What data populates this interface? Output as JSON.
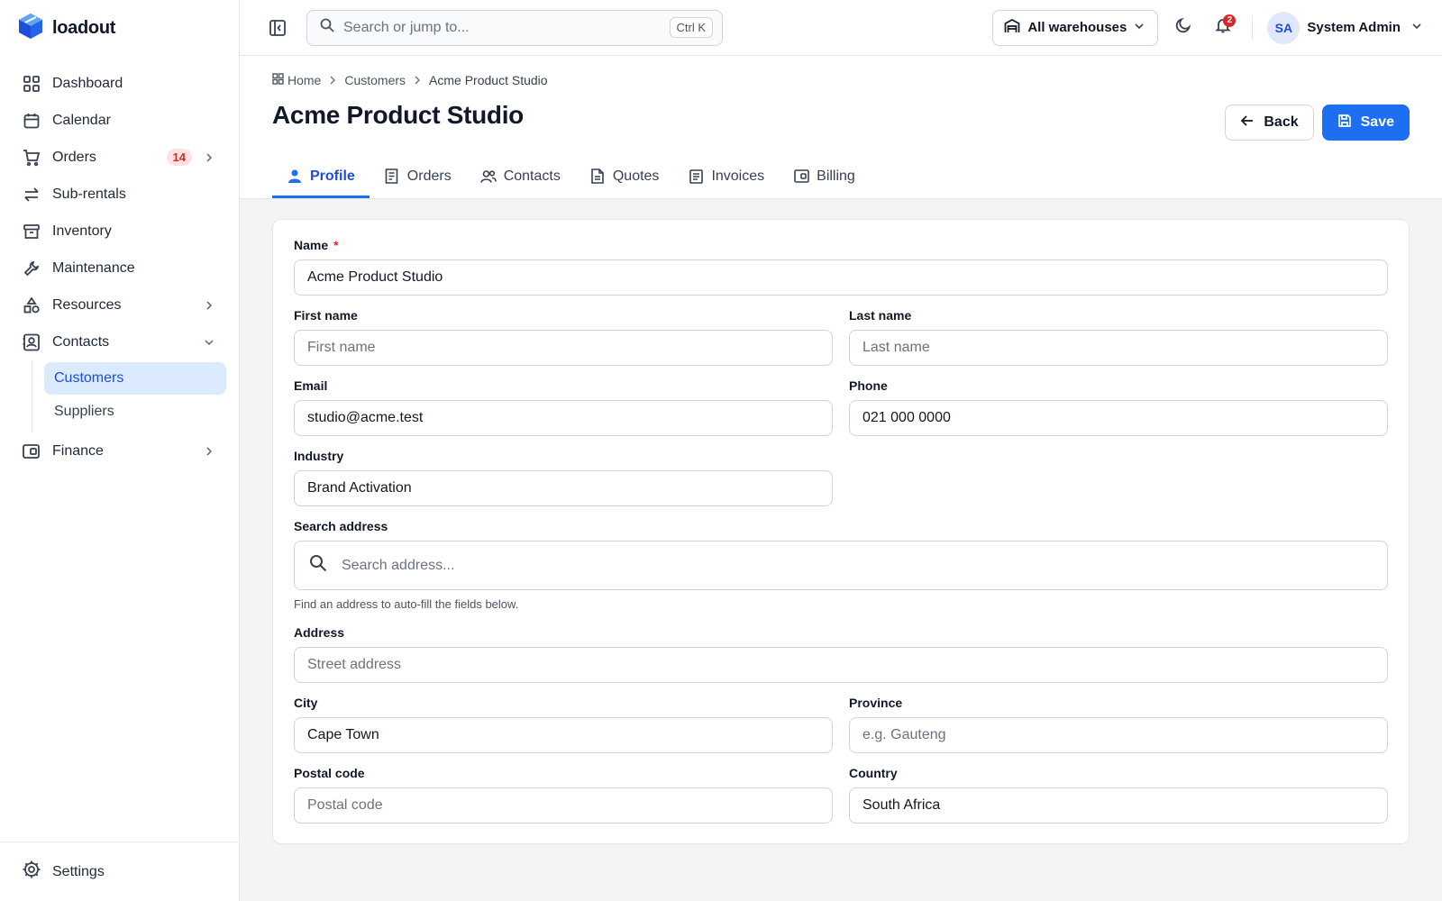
{
  "app": {
    "name": "loadout",
    "brand_color": "#2563eb"
  },
  "sidebar": {
    "items": [
      {
        "label": "Dashboard",
        "icon": "grid-icon"
      },
      {
        "label": "Calendar",
        "icon": "calendar-icon"
      },
      {
        "label": "Orders",
        "icon": "cart-icon",
        "badge": "14"
      },
      {
        "label": "Sub-rentals",
        "icon": "arrows-icon"
      },
      {
        "label": "Inventory",
        "icon": "archive-icon"
      },
      {
        "label": "Maintenance",
        "icon": "wrench-icon"
      },
      {
        "label": "Resources",
        "icon": "shapes-icon"
      },
      {
        "label": "Contacts",
        "icon": "contact-card-icon"
      },
      {
        "label": "Finance",
        "icon": "wallet-icon"
      }
    ],
    "contacts_sub": [
      {
        "label": "Customers",
        "active": true
      },
      {
        "label": "Suppliers",
        "active": false
      }
    ],
    "footer": {
      "label": "Settings",
      "icon": "gear-icon"
    }
  },
  "topbar": {
    "search_placeholder": "Search or jump to...",
    "search_shortcut": "Ctrl K",
    "warehouse": "All warehouses",
    "notifications": "2",
    "user_initials": "SA",
    "user_name": "System Admin"
  },
  "breadcrumb": {
    "home": "Home",
    "section": "Customers",
    "current": "Acme Product Studio"
  },
  "page": {
    "title": "Acme Product Studio",
    "back_label": "Back",
    "save_label": "Save"
  },
  "tabs": [
    {
      "label": "Profile",
      "icon": "user-icon",
      "active": true
    },
    {
      "label": "Orders",
      "icon": "receipt-icon"
    },
    {
      "label": "Contacts",
      "icon": "users-icon"
    },
    {
      "label": "Quotes",
      "icon": "file-icon"
    },
    {
      "label": "Invoices",
      "icon": "invoice-icon"
    },
    {
      "label": "Billing",
      "icon": "wallet-icon"
    }
  ],
  "form": {
    "name": {
      "label": "Name",
      "required": "*",
      "value": "Acme Product Studio"
    },
    "first_name": {
      "label": "First name",
      "placeholder": "First name"
    },
    "last_name": {
      "label": "Last name",
      "placeholder": "Last name"
    },
    "email": {
      "label": "Email",
      "value": "studio@acme.test"
    },
    "phone": {
      "label": "Phone",
      "value": "021 000 0000"
    },
    "industry": {
      "label": "Industry",
      "value": "Brand Activation"
    },
    "search_address": {
      "label": "Search address",
      "placeholder": "Search address...",
      "help": "Find an address to auto-fill the fields below."
    },
    "address": {
      "label": "Address",
      "placeholder": "Street address"
    },
    "city": {
      "label": "City",
      "value": "Cape Town"
    },
    "province": {
      "label": "Province",
      "placeholder": "e.g. Gauteng"
    },
    "postal_code": {
      "label": "Postal code",
      "placeholder": "Postal code"
    },
    "country": {
      "label": "Country",
      "value": "South Africa"
    }
  }
}
